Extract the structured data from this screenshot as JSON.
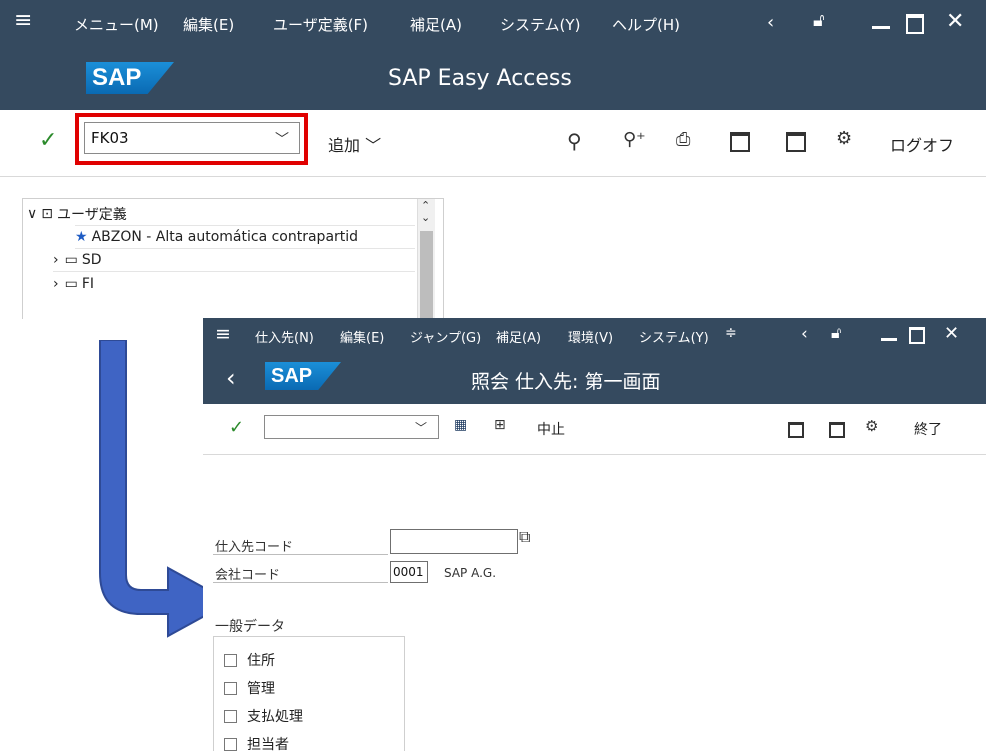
{
  "window1": {
    "menu": [
      "メニュー(M)",
      "編集(E)",
      "ユーザ定義(F)",
      "補足(A)",
      "システム(Y)",
      "ヘルプ(H)"
    ],
    "title": "SAP Easy Access",
    "logo": "SAP",
    "command_value": "FK03",
    "add_label": "追加",
    "logoff_label": "ログオフ",
    "tree": {
      "root": "ユーザ定義",
      "items": [
        {
          "label": "ABZON - Alta automática contrapartid"
        },
        {
          "label": "SD"
        },
        {
          "label": "FI"
        }
      ]
    }
  },
  "window2": {
    "menu": [
      "仕入先(N)",
      "編集(E)",
      "ジャンプ(G)",
      "補足(A)",
      "環境(V)",
      "システム(Y)"
    ],
    "title": "照会 仕入先: 第一画面",
    "logo": "SAP",
    "cancel_label": "中止",
    "exit_label": "終了",
    "fields": {
      "vendor_label": "仕入先コード",
      "vendor_value": "",
      "company_label": "会社コード",
      "company_value": "0001",
      "company_name": "SAP A.G."
    },
    "general_data": {
      "title": "一般データ",
      "options": [
        "住所",
        "管理",
        "支払処理",
        "担当者"
      ]
    }
  },
  "colors": {
    "shell": "#354a5f",
    "highlight": "#e00000",
    "arrow": "#3f64c4"
  }
}
